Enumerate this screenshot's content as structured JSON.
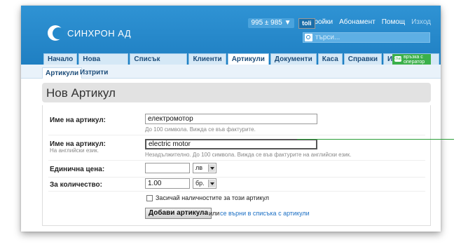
{
  "app": {
    "brand": "СИНХРОН АД",
    "counter": "995 ± 985 ▼"
  },
  "top_links": {
    "settings": "Настройки",
    "subscription": "Абонамент",
    "help": "Помощ",
    "user": "toli",
    "logout": "Изход"
  },
  "search": {
    "placeholder": "търси..."
  },
  "tabs": [
    "Начало",
    "Нова Фактура",
    "Списък Фактури",
    "Клиенти",
    "Артикули",
    "Документи",
    "Каса",
    "Справки",
    "Импорт/експорт"
  ],
  "chat": {
    "label": "връзка с оператор",
    "icon_text": "chat"
  },
  "subtabs": [
    "Артикули",
    "Изтрити"
  ],
  "page": {
    "title": "Нов Артикул"
  },
  "form": {
    "name_label": "Име на артикул:",
    "name_value": "електромотор",
    "name_hint": "До 100 символа. Вижда се във фактурите.",
    "name_en_label": "Име на артикул:",
    "name_en_sublabel": "На английски език.",
    "name_en_value": "electric motor",
    "name_en_hint": "Незадължително. До 100 символа. Вижда се във фактурите на английски език.",
    "price_label": "Единична цена:",
    "price_value": "",
    "currency": "лв",
    "qty_label": "За количество:",
    "qty_value": "1.00",
    "unit": "бр.",
    "stock_label": "Засичай наличностите за този артикул",
    "submit": "Добави артикула",
    "or_text": "или",
    "back_link": "се върни в списъка с артикули"
  },
  "colors": {
    "header_blue": "#2589cb",
    "chat_green": "#3bb04a",
    "pointer_green": "#2a9d37"
  }
}
